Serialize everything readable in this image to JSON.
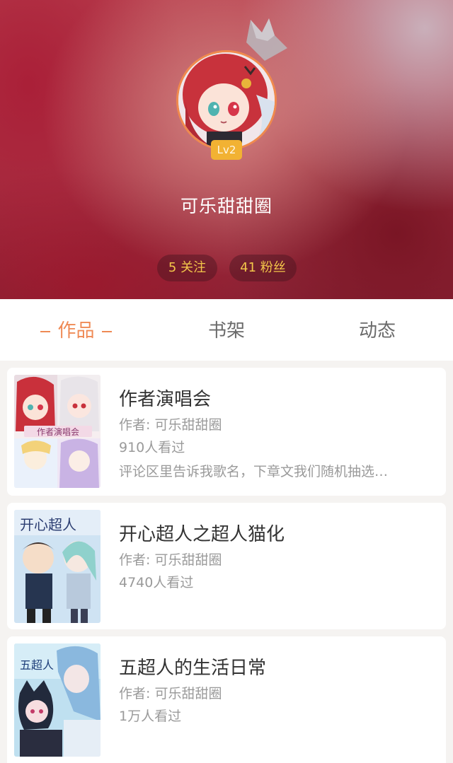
{
  "profile": {
    "username": "可乐甜甜圈",
    "level": "Lv2",
    "following": "5 关注",
    "fans": "41 粉丝"
  },
  "tabs": [
    {
      "label": "作品",
      "active": true
    },
    {
      "label": "书架",
      "active": false
    },
    {
      "label": "动态",
      "active": false
    }
  ],
  "works": [
    {
      "title": "作者演唱会",
      "author": "作者: 可乐甜甜圈",
      "views": "910人看过",
      "description": "评论区里告诉我歌名，下章文我们随机抽选…",
      "cover_text": "作者演唱会"
    },
    {
      "title": "开心超人之超人猫化",
      "author": "作者: 可乐甜甜圈",
      "views": "4740人看过",
      "cover_text": "开心超人"
    },
    {
      "title": "五超人的生活日常",
      "author": "作者: 可乐甜甜圈",
      "views": "1万人看过",
      "cover_text": "五超人"
    }
  ],
  "colors": {
    "accent": "#ef8a55",
    "level_badge": "#f2b233",
    "stat_text": "#f3c64a",
    "header_red": "#a83445"
  },
  "icons": {
    "crown": "crown-icon"
  }
}
